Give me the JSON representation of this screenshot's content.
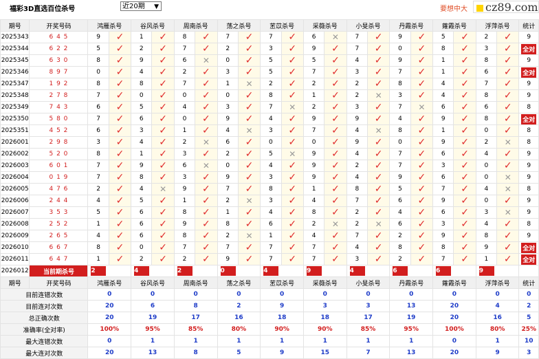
{
  "header": {
    "title": "福彩3D直选百位杀号",
    "period_select": "近20期",
    "promo": "要想中大",
    "watermark": "cz89.com"
  },
  "columns": {
    "period": "期号",
    "number": "开奖号码",
    "killers": [
      "鸿雁杀号",
      "谷风杀号",
      "周南杀号",
      "荡之杀号",
      "苤苡杀号",
      "采薇杀号",
      "小旻杀号",
      "丹霞杀号",
      "蕹霞杀号",
      "浮萍杀号"
    ],
    "stat": "统计"
  },
  "rows": [
    {
      "period": "2025343",
      "num": "6 4 5",
      "k": [
        [
          "9",
          1
        ],
        [
          "1",
          1
        ],
        [
          "8",
          1
        ],
        [
          "7",
          1
        ],
        [
          "7",
          1
        ],
        [
          "6",
          0
        ],
        [
          "7",
          1
        ],
        [
          "9",
          1
        ],
        [
          "5",
          1
        ],
        [
          "2",
          1
        ]
      ],
      "stat": "9"
    },
    {
      "period": "2025344",
      "num": "6 2 2",
      "k": [
        [
          "5",
          1
        ],
        [
          "2",
          1
        ],
        [
          "7",
          1
        ],
        [
          "2",
          1
        ],
        [
          "3",
          1
        ],
        [
          "9",
          1
        ],
        [
          "7",
          1
        ],
        [
          "0",
          1
        ],
        [
          "8",
          1
        ],
        [
          "3",
          1
        ]
      ],
      "stat": "全对"
    },
    {
      "period": "2025345",
      "num": "6 3 0",
      "k": [
        [
          "8",
          1
        ],
        [
          "9",
          1
        ],
        [
          "6",
          0
        ],
        [
          "0",
          1
        ],
        [
          "5",
          1
        ],
        [
          "5",
          1
        ],
        [
          "4",
          1
        ],
        [
          "9",
          1
        ],
        [
          "1",
          1
        ],
        [
          "8",
          1
        ]
      ],
      "stat": "9"
    },
    {
      "period": "2025346",
      "num": "8 9 7",
      "k": [
        [
          "0",
          1
        ],
        [
          "4",
          1
        ],
        [
          "2",
          1
        ],
        [
          "3",
          1
        ],
        [
          "5",
          1
        ],
        [
          "7",
          1
        ],
        [
          "3",
          1
        ],
        [
          "7",
          1
        ],
        [
          "1",
          1
        ],
        [
          "6",
          1
        ]
      ],
      "stat": "全对"
    },
    {
      "period": "2025347",
      "num": "1 9 2",
      "k": [
        [
          "8",
          1
        ],
        [
          "8",
          1
        ],
        [
          "7",
          1
        ],
        [
          "1",
          0
        ],
        [
          "2",
          1
        ],
        [
          "2",
          1
        ],
        [
          "2",
          1
        ],
        [
          "8",
          1
        ],
        [
          "4",
          1
        ],
        [
          "7",
          1
        ]
      ],
      "stat": "9"
    },
    {
      "period": "2025348",
      "num": "2 7 8",
      "k": [
        [
          "7",
          1
        ],
        [
          "0",
          1
        ],
        [
          "0",
          1
        ],
        [
          "0",
          1
        ],
        [
          "8",
          1
        ],
        [
          "1",
          1
        ],
        [
          "2",
          0
        ],
        [
          "3",
          1
        ],
        [
          "4",
          1
        ],
        [
          "8",
          1
        ]
      ],
      "stat": "9"
    },
    {
      "period": "2025349",
      "num": "7 4 3",
      "k": [
        [
          "6",
          1
        ],
        [
          "5",
          1
        ],
        [
          "4",
          1
        ],
        [
          "3",
          1
        ],
        [
          "7",
          0
        ],
        [
          "2",
          1
        ],
        [
          "3",
          1
        ],
        [
          "7",
          0
        ],
        [
          "6",
          1
        ],
        [
          "6",
          1
        ]
      ],
      "stat": "8"
    },
    {
      "period": "2025350",
      "num": "5 8 0",
      "k": [
        [
          "7",
          1
        ],
        [
          "6",
          1
        ],
        [
          "0",
          1
        ],
        [
          "9",
          1
        ],
        [
          "4",
          1
        ],
        [
          "9",
          1
        ],
        [
          "9",
          1
        ],
        [
          "4",
          1
        ],
        [
          "9",
          1
        ],
        [
          "8",
          1
        ]
      ],
      "stat": "全对"
    },
    {
      "period": "2025351",
      "num": "4 5 2",
      "k": [
        [
          "6",
          1
        ],
        [
          "3",
          1
        ],
        [
          "1",
          1
        ],
        [
          "4",
          0
        ],
        [
          "3",
          1
        ],
        [
          "7",
          1
        ],
        [
          "4",
          0
        ],
        [
          "8",
          1
        ],
        [
          "1",
          1
        ],
        [
          "0",
          1
        ]
      ],
      "stat": "8"
    },
    {
      "period": "2026001",
      "num": "2 9 8",
      "k": [
        [
          "3",
          1
        ],
        [
          "4",
          1
        ],
        [
          "2",
          0
        ],
        [
          "6",
          1
        ],
        [
          "0",
          1
        ],
        [
          "0",
          1
        ],
        [
          "9",
          1
        ],
        [
          "0",
          1
        ],
        [
          "9",
          1
        ],
        [
          "2",
          0
        ]
      ],
      "stat": "8"
    },
    {
      "period": "2026002",
      "num": "5 2 0",
      "k": [
        [
          "8",
          1
        ],
        [
          "1",
          1
        ],
        [
          "3",
          1
        ],
        [
          "2",
          1
        ],
        [
          "5",
          0
        ],
        [
          "9",
          1
        ],
        [
          "4",
          1
        ],
        [
          "7",
          1
        ],
        [
          "6",
          1
        ],
        [
          "4",
          1
        ]
      ],
      "stat": "9"
    },
    {
      "period": "2026003",
      "num": "6 0 1",
      "k": [
        [
          "7",
          1
        ],
        [
          "9",
          1
        ],
        [
          "6",
          0
        ],
        [
          "0",
          1
        ],
        [
          "4",
          1
        ],
        [
          "9",
          1
        ],
        [
          "2",
          1
        ],
        [
          "7",
          1
        ],
        [
          "3",
          1
        ],
        [
          "0",
          1
        ]
      ],
      "stat": "9"
    },
    {
      "period": "2026004",
      "num": "0 1 9",
      "k": [
        [
          "7",
          1
        ],
        [
          "8",
          1
        ],
        [
          "3",
          1
        ],
        [
          "9",
          1
        ],
        [
          "3",
          1
        ],
        [
          "9",
          1
        ],
        [
          "4",
          1
        ],
        [
          "9",
          1
        ],
        [
          "6",
          1
        ],
        [
          "0",
          0
        ]
      ],
      "stat": "9"
    },
    {
      "period": "2026005",
      "num": "4 7 6",
      "k": [
        [
          "2",
          1
        ],
        [
          "4",
          0
        ],
        [
          "9",
          1
        ],
        [
          "7",
          1
        ],
        [
          "8",
          1
        ],
        [
          "1",
          1
        ],
        [
          "8",
          1
        ],
        [
          "5",
          1
        ],
        [
          "7",
          1
        ],
        [
          "4",
          0
        ]
      ],
      "stat": "8"
    },
    {
      "period": "2026006",
      "num": "2 4 4",
      "k": [
        [
          "4",
          1
        ],
        [
          "5",
          1
        ],
        [
          "1",
          1
        ],
        [
          "2",
          0
        ],
        [
          "3",
          1
        ],
        [
          "4",
          1
        ],
        [
          "7",
          1
        ],
        [
          "6",
          1
        ],
        [
          "9",
          1
        ],
        [
          "0",
          1
        ]
      ],
      "stat": "9"
    },
    {
      "period": "2026007",
      "num": "3 5 3",
      "k": [
        [
          "5",
          1
        ],
        [
          "6",
          1
        ],
        [
          "8",
          1
        ],
        [
          "1",
          1
        ],
        [
          "4",
          1
        ],
        [
          "8",
          1
        ],
        [
          "2",
          1
        ],
        [
          "4",
          1
        ],
        [
          "6",
          1
        ],
        [
          "3",
          0
        ]
      ],
      "stat": "9"
    },
    {
      "period": "2026008",
      "num": "2 5 2",
      "k": [
        [
          "1",
          1
        ],
        [
          "6",
          1
        ],
        [
          "9",
          1
        ],
        [
          "8",
          1
        ],
        [
          "6",
          1
        ],
        [
          "2",
          0
        ],
        [
          "2",
          0
        ],
        [
          "6",
          1
        ],
        [
          "3",
          1
        ],
        [
          "4",
          1
        ]
      ],
      "stat": "8"
    },
    {
      "period": "2026009",
      "num": "2 6 5",
      "k": [
        [
          "4",
          1
        ],
        [
          "6",
          1
        ],
        [
          "8",
          1
        ],
        [
          "2",
          0
        ],
        [
          "1",
          1
        ],
        [
          "4",
          1
        ],
        [
          "7",
          1
        ],
        [
          "2",
          1
        ],
        [
          "9",
          1
        ],
        [
          "8",
          1
        ]
      ],
      "stat": "9"
    },
    {
      "period": "2026010",
      "num": "6 6 7",
      "k": [
        [
          "8",
          1
        ],
        [
          "0",
          1
        ],
        [
          "7",
          1
        ],
        [
          "7",
          1
        ],
        [
          "7",
          1
        ],
        [
          "7",
          1
        ],
        [
          "4",
          1
        ],
        [
          "8",
          1
        ],
        [
          "8",
          1
        ],
        [
          "9",
          1
        ]
      ],
      "stat": "全对"
    },
    {
      "period": "2026011",
      "num": "6 4 7",
      "k": [
        [
          "1",
          1
        ],
        [
          "2",
          1
        ],
        [
          "2",
          1
        ],
        [
          "9",
          1
        ],
        [
          "7",
          1
        ],
        [
          "7",
          1
        ],
        [
          "3",
          1
        ],
        [
          "2",
          1
        ],
        [
          "7",
          1
        ],
        [
          "1",
          1
        ]
      ],
      "stat": "全对"
    }
  ],
  "current": {
    "period": "2026012",
    "label": "当前期杀号",
    "values": [
      "2",
      "4",
      "2",
      "0",
      "4",
      "9",
      "4",
      "6",
      "6",
      "9"
    ]
  },
  "summary": [
    {
      "label": "目前连错次数",
      "values": [
        "0",
        "0",
        "0",
        "0",
        "0",
        "0",
        "0",
        "0",
        "0",
        "0"
      ],
      "stat": "0",
      "color": "blue"
    },
    {
      "label": "目前连对次数",
      "values": [
        "20",
        "6",
        "8",
        "2",
        "9",
        "3",
        "3",
        "13",
        "20",
        "4"
      ],
      "stat": "2",
      "color": "blue"
    },
    {
      "label": "总正确次数",
      "values": [
        "20",
        "19",
        "17",
        "16",
        "18",
        "18",
        "17",
        "19",
        "20",
        "16"
      ],
      "stat": "5",
      "color": "blue"
    },
    {
      "label": "准确率(全对率)",
      "values": [
        "100%",
        "95%",
        "85%",
        "80%",
        "90%",
        "90%",
        "85%",
        "95%",
        "100%",
        "80%"
      ],
      "stat": "25%",
      "color": "red"
    },
    {
      "label": "最大连错次数",
      "values": [
        "0",
        "1",
        "1",
        "1",
        "1",
        "1",
        "1",
        "1",
        "0",
        "1"
      ],
      "stat": "10",
      "color": "blue"
    },
    {
      "label": "最大连对次数",
      "values": [
        "20",
        "13",
        "8",
        "5",
        "9",
        "15",
        "7",
        "13",
        "20",
        "9"
      ],
      "stat": "3",
      "color": "blue"
    }
  ],
  "icons": {
    "tick": "check-icon",
    "cross": "cross-icon"
  },
  "colors": {
    "accent": "#d21e1e",
    "blue": "#1e3cc8",
    "tick": "#e02a2a",
    "promo": "#e0502a"
  }
}
